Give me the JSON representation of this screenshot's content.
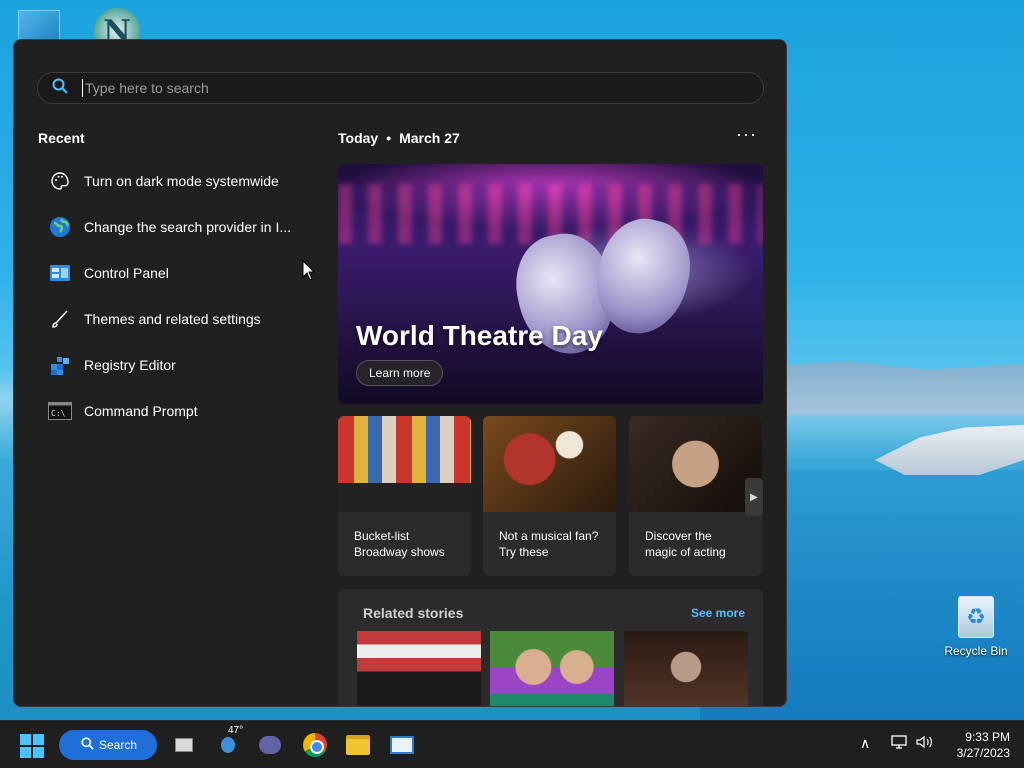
{
  "desktop": {
    "netscape_letter": "N",
    "recycle_bin_label": "Recycle Bin"
  },
  "search": {
    "placeholder": "Type here to search"
  },
  "recent": {
    "title": "Recent",
    "items": [
      {
        "label": "Turn on dark mode systemwide",
        "icon": "palette-icon"
      },
      {
        "label": "Change the search provider in I...",
        "icon": "globe-icon"
      },
      {
        "label": "Control Panel",
        "icon": "control-panel-icon"
      },
      {
        "label": "Themes and related settings",
        "icon": "brush-icon"
      },
      {
        "label": "Registry Editor",
        "icon": "registry-icon"
      },
      {
        "label": "Command Prompt",
        "icon": "cmd-icon"
      }
    ]
  },
  "today": {
    "label": "Today",
    "separator": "•",
    "date": "March 27",
    "more": "···"
  },
  "hero": {
    "title": "World Theatre Day",
    "button": "Learn more"
  },
  "cards": [
    {
      "line1": "Bucket-list",
      "line2": "Broadway shows"
    },
    {
      "line1": "Not a musical fan?",
      "line2": "Try these"
    },
    {
      "line1": "Discover the",
      "line2": "magic of acting"
    }
  ],
  "related": {
    "title": "Related stories",
    "see_more": "See more"
  },
  "taskbar": {
    "search_label": "Search",
    "weather_temp": "47°",
    "time": "9:33 PM",
    "date": "3/27/2023"
  },
  "colors": {
    "accent": "#4cc2ff",
    "panel_bg": "#202020",
    "taskbar_search": "#1f6fd9"
  }
}
